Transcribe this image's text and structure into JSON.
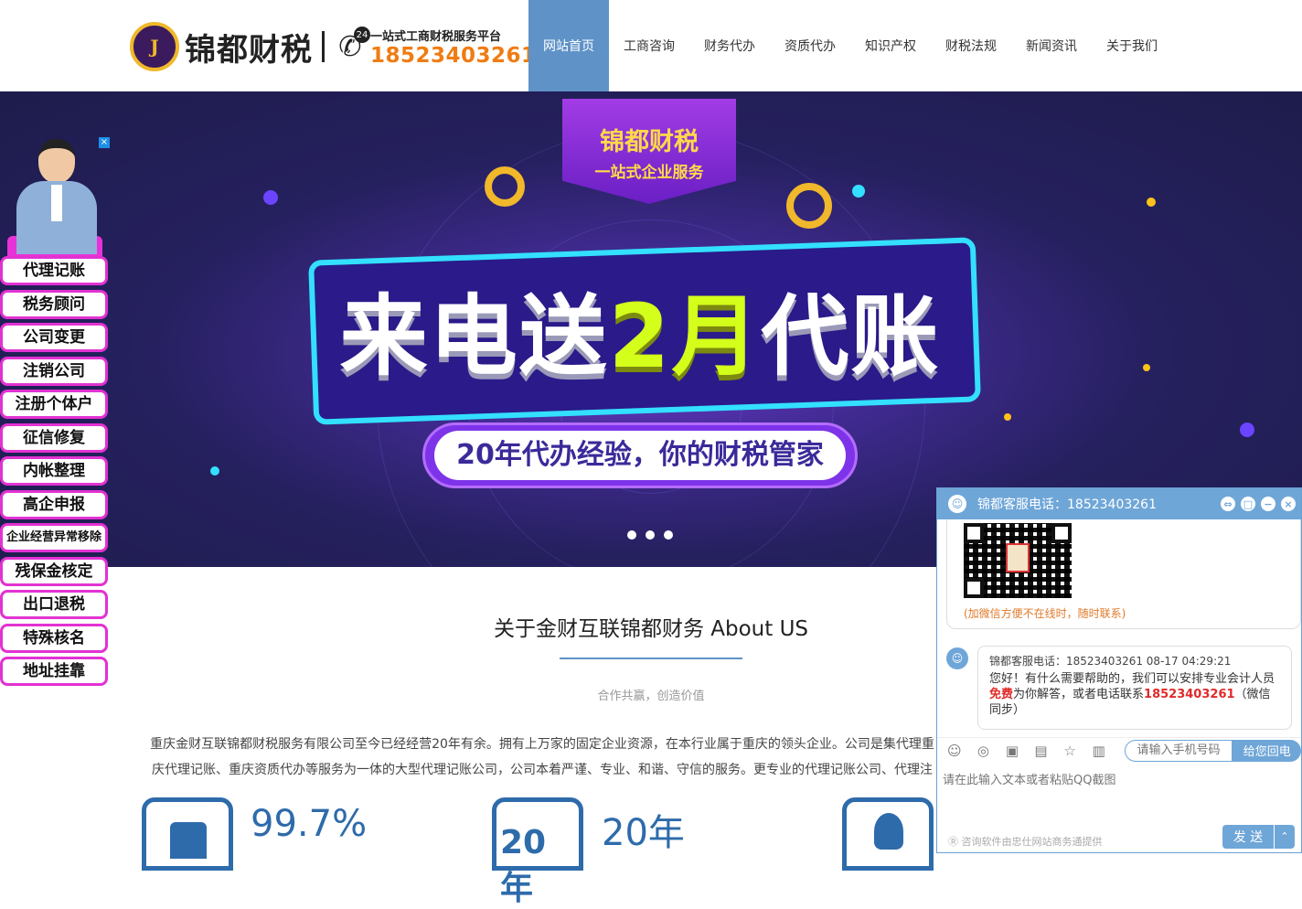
{
  "header": {
    "logo_seal": "J",
    "logo_name": "锦都财税",
    "slogan": "一站式工商财税服务平台",
    "phone": "18523403261",
    "badge": "24",
    "nav": [
      "网站首页",
      "工商咨询",
      "财务代办",
      "资质代办",
      "知识产权",
      "财税法规",
      "新闻资讯",
      "关于我们"
    ],
    "active_index": 0
  },
  "banner": {
    "ribbon_title": "锦都财税",
    "ribbon_sub": "一站式企业服务",
    "headline_a": "来电送",
    "headline_b": "2月",
    "headline_c": "代账",
    "subline": "20年代办经验，你的财税管家",
    "slides": 3
  },
  "float_menu": {
    "close": "×",
    "items": [
      "代理记账",
      "税务顾问",
      "公司变更",
      "注销公司",
      "注册个体户",
      "征信修复",
      "内帐整理",
      "高企申报",
      "企业经营异常移除",
      "残保金核定",
      "出口退税",
      "特殊核名",
      "地址挂靠"
    ]
  },
  "about": {
    "title": "关于金财互联锦都财务 About US",
    "subtitle": "合作共赢，创造价值",
    "text": "重庆金财互联锦都财税服务有限公司至今已经经营20年有余。拥有上万家的固定企业资源，在本行业属于重庆的领头企业。公司是集代理重庆代理记账、重庆资质代办等服务为一体的大型代理记账公司，公司本着严谨、专业、和谐、守信的服务。更专业的代理记账公司、代理注册公司",
    "stats": [
      {
        "value": "99.7%",
        "icon": "thumbs-up-icon"
      },
      {
        "value": "20年",
        "icon": "20-years-icon",
        "icon_text": "20年"
      },
      {
        "value": "",
        "icon": "person-icon"
      }
    ]
  },
  "chat": {
    "title": "锦都客服电话：18523403261",
    "qr_note": "(加微信方便不在线时，随时联系)",
    "msg_meta": "锦都客服电话：18523403261  08-17 04:29:21",
    "msg_1": "您好！有什么需要帮助的，我们可以安排专业会计人员",
    "msg_free": "免费",
    "msg_2": "为你解答，或者电话联系",
    "msg_phone": "18523403261",
    "msg_3": "（微信同步）",
    "phone_placeholder": "请输入手机号码",
    "callback": "给您回电",
    "input_placeholder": "请在此输入文本或者粘贴QQ截图",
    "footer": "咨询软件由忠仕网站商务通提供",
    "send": "发 送",
    "controls": [
      "⇔",
      "□",
      "−",
      "×"
    ],
    "toolbar_icons": [
      "emoji-icon",
      "wechat-icon",
      "image-icon",
      "folder-icon",
      "star-icon",
      "save-icon"
    ]
  }
}
